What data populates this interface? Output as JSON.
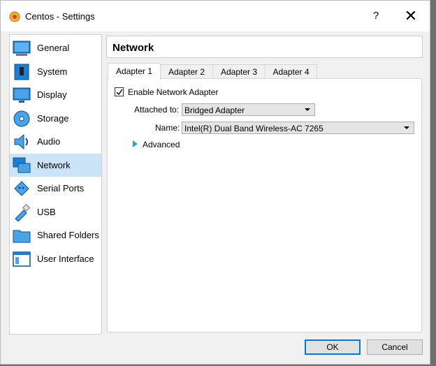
{
  "window": {
    "title": "Centos - Settings",
    "help_label": "?",
    "close_label": "✕"
  },
  "sidebar": {
    "items": [
      {
        "label": "General",
        "icon": "general-icon",
        "selected": false
      },
      {
        "label": "System",
        "icon": "system-icon",
        "selected": false
      },
      {
        "label": "Display",
        "icon": "display-icon",
        "selected": false
      },
      {
        "label": "Storage",
        "icon": "storage-icon",
        "selected": false
      },
      {
        "label": "Audio",
        "icon": "audio-icon",
        "selected": false
      },
      {
        "label": "Network",
        "icon": "network-icon",
        "selected": true
      },
      {
        "label": "Serial Ports",
        "icon": "serial-ports-icon",
        "selected": false
      },
      {
        "label": "USB",
        "icon": "usb-icon",
        "selected": false
      },
      {
        "label": "Shared Folders",
        "icon": "shared-folders-icon",
        "selected": false
      },
      {
        "label": "User Interface",
        "icon": "user-interface-icon",
        "selected": false
      }
    ]
  },
  "page": {
    "title": "Network"
  },
  "tabs": [
    {
      "label": "Adapter 1",
      "active": true
    },
    {
      "label": "Adapter 2",
      "active": false
    },
    {
      "label": "Adapter 3",
      "active": false
    },
    {
      "label": "Adapter 4",
      "active": false
    }
  ],
  "adapter": {
    "enable_label": "Enable Network Adapter",
    "enabled": true,
    "attached_label": "Attached to:",
    "attached_value": "Bridged Adapter",
    "name_label": "Name:",
    "name_value": "Intel(R) Dual Band Wireless-AC 7265",
    "advanced_label": "Advanced"
  },
  "buttons": {
    "ok": "OK",
    "cancel": "Cancel"
  },
  "colors": {
    "selection": "#cce4f7",
    "focus_border": "#0078d7",
    "background": "#f0f0f0"
  }
}
